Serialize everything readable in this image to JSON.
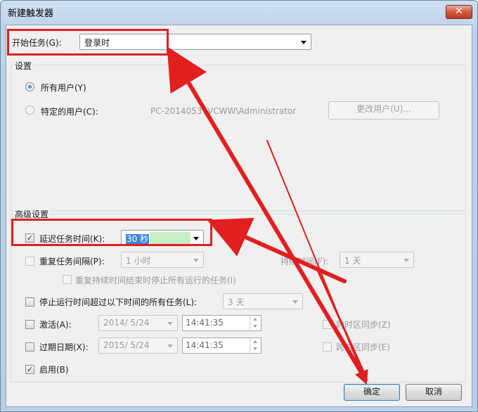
{
  "window": {
    "title": "新建触发器",
    "close_glyph": "✕"
  },
  "begin_task": {
    "label": "开始任务(G):",
    "value": "登录时"
  },
  "settings": {
    "group_label": "设置",
    "all_users_label": "所有用户(Y)",
    "specific_user_label": "特定的用户(C):",
    "specific_user_value": "PC-20140531VCWW\\Administrator",
    "change_user_button": "更改用户(U)..."
  },
  "advanced": {
    "group_label": "高级设置",
    "delay": {
      "label": "延迟任务时间(K):",
      "value": "30 秒",
      "checked": true
    },
    "repeat": {
      "label": "重复任务间隔(P):",
      "value": "1 小时",
      "duration_label": "持续时间(F):",
      "duration_value": "1 天"
    },
    "stop_all_label": "重复持续时间结束时停止所有运行的任务(I)",
    "stop_longer": {
      "label": "停止运行时间超过以下时间的所有任务(L):",
      "value": "3 天"
    },
    "activate": {
      "label": "激活(A):",
      "date": "2014/ 5/24",
      "time": "14:41:35",
      "sync_label": "跨时区同步(Z)"
    },
    "expire": {
      "label": "过期日期(X):",
      "date": "2015/ 5/24",
      "time": "14:41:35",
      "sync_label": "跨时区同步(E)"
    },
    "enabled": {
      "label": "启用(B)",
      "checked": true
    }
  },
  "buttons": {
    "ok": "确定",
    "cancel": "取消"
  },
  "annotation_color": "#e21f1f"
}
